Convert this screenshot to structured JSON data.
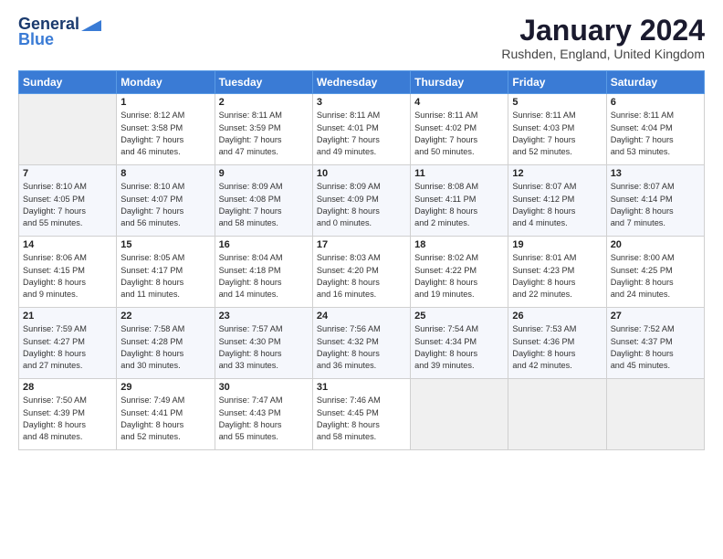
{
  "logo": {
    "line1": "General",
    "line2": "Blue"
  },
  "header": {
    "month": "January 2024",
    "location": "Rushden, England, United Kingdom"
  },
  "weekdays": [
    "Sunday",
    "Monday",
    "Tuesday",
    "Wednesday",
    "Thursday",
    "Friday",
    "Saturday"
  ],
  "weeks": [
    [
      {
        "day": "",
        "info": ""
      },
      {
        "day": "1",
        "info": "Sunrise: 8:12 AM\nSunset: 3:58 PM\nDaylight: 7 hours\nand 46 minutes."
      },
      {
        "day": "2",
        "info": "Sunrise: 8:11 AM\nSunset: 3:59 PM\nDaylight: 7 hours\nand 47 minutes."
      },
      {
        "day": "3",
        "info": "Sunrise: 8:11 AM\nSunset: 4:01 PM\nDaylight: 7 hours\nand 49 minutes."
      },
      {
        "day": "4",
        "info": "Sunrise: 8:11 AM\nSunset: 4:02 PM\nDaylight: 7 hours\nand 50 minutes."
      },
      {
        "day": "5",
        "info": "Sunrise: 8:11 AM\nSunset: 4:03 PM\nDaylight: 7 hours\nand 52 minutes."
      },
      {
        "day": "6",
        "info": "Sunrise: 8:11 AM\nSunset: 4:04 PM\nDaylight: 7 hours\nand 53 minutes."
      }
    ],
    [
      {
        "day": "7",
        "info": "Sunrise: 8:10 AM\nSunset: 4:05 PM\nDaylight: 7 hours\nand 55 minutes."
      },
      {
        "day": "8",
        "info": "Sunrise: 8:10 AM\nSunset: 4:07 PM\nDaylight: 7 hours\nand 56 minutes."
      },
      {
        "day": "9",
        "info": "Sunrise: 8:09 AM\nSunset: 4:08 PM\nDaylight: 7 hours\nand 58 minutes."
      },
      {
        "day": "10",
        "info": "Sunrise: 8:09 AM\nSunset: 4:09 PM\nDaylight: 8 hours\nand 0 minutes."
      },
      {
        "day": "11",
        "info": "Sunrise: 8:08 AM\nSunset: 4:11 PM\nDaylight: 8 hours\nand 2 minutes."
      },
      {
        "day": "12",
        "info": "Sunrise: 8:07 AM\nSunset: 4:12 PM\nDaylight: 8 hours\nand 4 minutes."
      },
      {
        "day": "13",
        "info": "Sunrise: 8:07 AM\nSunset: 4:14 PM\nDaylight: 8 hours\nand 7 minutes."
      }
    ],
    [
      {
        "day": "14",
        "info": "Sunrise: 8:06 AM\nSunset: 4:15 PM\nDaylight: 8 hours\nand 9 minutes."
      },
      {
        "day": "15",
        "info": "Sunrise: 8:05 AM\nSunset: 4:17 PM\nDaylight: 8 hours\nand 11 minutes."
      },
      {
        "day": "16",
        "info": "Sunrise: 8:04 AM\nSunset: 4:18 PM\nDaylight: 8 hours\nand 14 minutes."
      },
      {
        "day": "17",
        "info": "Sunrise: 8:03 AM\nSunset: 4:20 PM\nDaylight: 8 hours\nand 16 minutes."
      },
      {
        "day": "18",
        "info": "Sunrise: 8:02 AM\nSunset: 4:22 PM\nDaylight: 8 hours\nand 19 minutes."
      },
      {
        "day": "19",
        "info": "Sunrise: 8:01 AM\nSunset: 4:23 PM\nDaylight: 8 hours\nand 22 minutes."
      },
      {
        "day": "20",
        "info": "Sunrise: 8:00 AM\nSunset: 4:25 PM\nDaylight: 8 hours\nand 24 minutes."
      }
    ],
    [
      {
        "day": "21",
        "info": "Sunrise: 7:59 AM\nSunset: 4:27 PM\nDaylight: 8 hours\nand 27 minutes."
      },
      {
        "day": "22",
        "info": "Sunrise: 7:58 AM\nSunset: 4:28 PM\nDaylight: 8 hours\nand 30 minutes."
      },
      {
        "day": "23",
        "info": "Sunrise: 7:57 AM\nSunset: 4:30 PM\nDaylight: 8 hours\nand 33 minutes."
      },
      {
        "day": "24",
        "info": "Sunrise: 7:56 AM\nSunset: 4:32 PM\nDaylight: 8 hours\nand 36 minutes."
      },
      {
        "day": "25",
        "info": "Sunrise: 7:54 AM\nSunset: 4:34 PM\nDaylight: 8 hours\nand 39 minutes."
      },
      {
        "day": "26",
        "info": "Sunrise: 7:53 AM\nSunset: 4:36 PM\nDaylight: 8 hours\nand 42 minutes."
      },
      {
        "day": "27",
        "info": "Sunrise: 7:52 AM\nSunset: 4:37 PM\nDaylight: 8 hours\nand 45 minutes."
      }
    ],
    [
      {
        "day": "28",
        "info": "Sunrise: 7:50 AM\nSunset: 4:39 PM\nDaylight: 8 hours\nand 48 minutes."
      },
      {
        "day": "29",
        "info": "Sunrise: 7:49 AM\nSunset: 4:41 PM\nDaylight: 8 hours\nand 52 minutes."
      },
      {
        "day": "30",
        "info": "Sunrise: 7:47 AM\nSunset: 4:43 PM\nDaylight: 8 hours\nand 55 minutes."
      },
      {
        "day": "31",
        "info": "Sunrise: 7:46 AM\nSunset: 4:45 PM\nDaylight: 8 hours\nand 58 minutes."
      },
      {
        "day": "",
        "info": ""
      },
      {
        "day": "",
        "info": ""
      },
      {
        "day": "",
        "info": ""
      }
    ]
  ]
}
